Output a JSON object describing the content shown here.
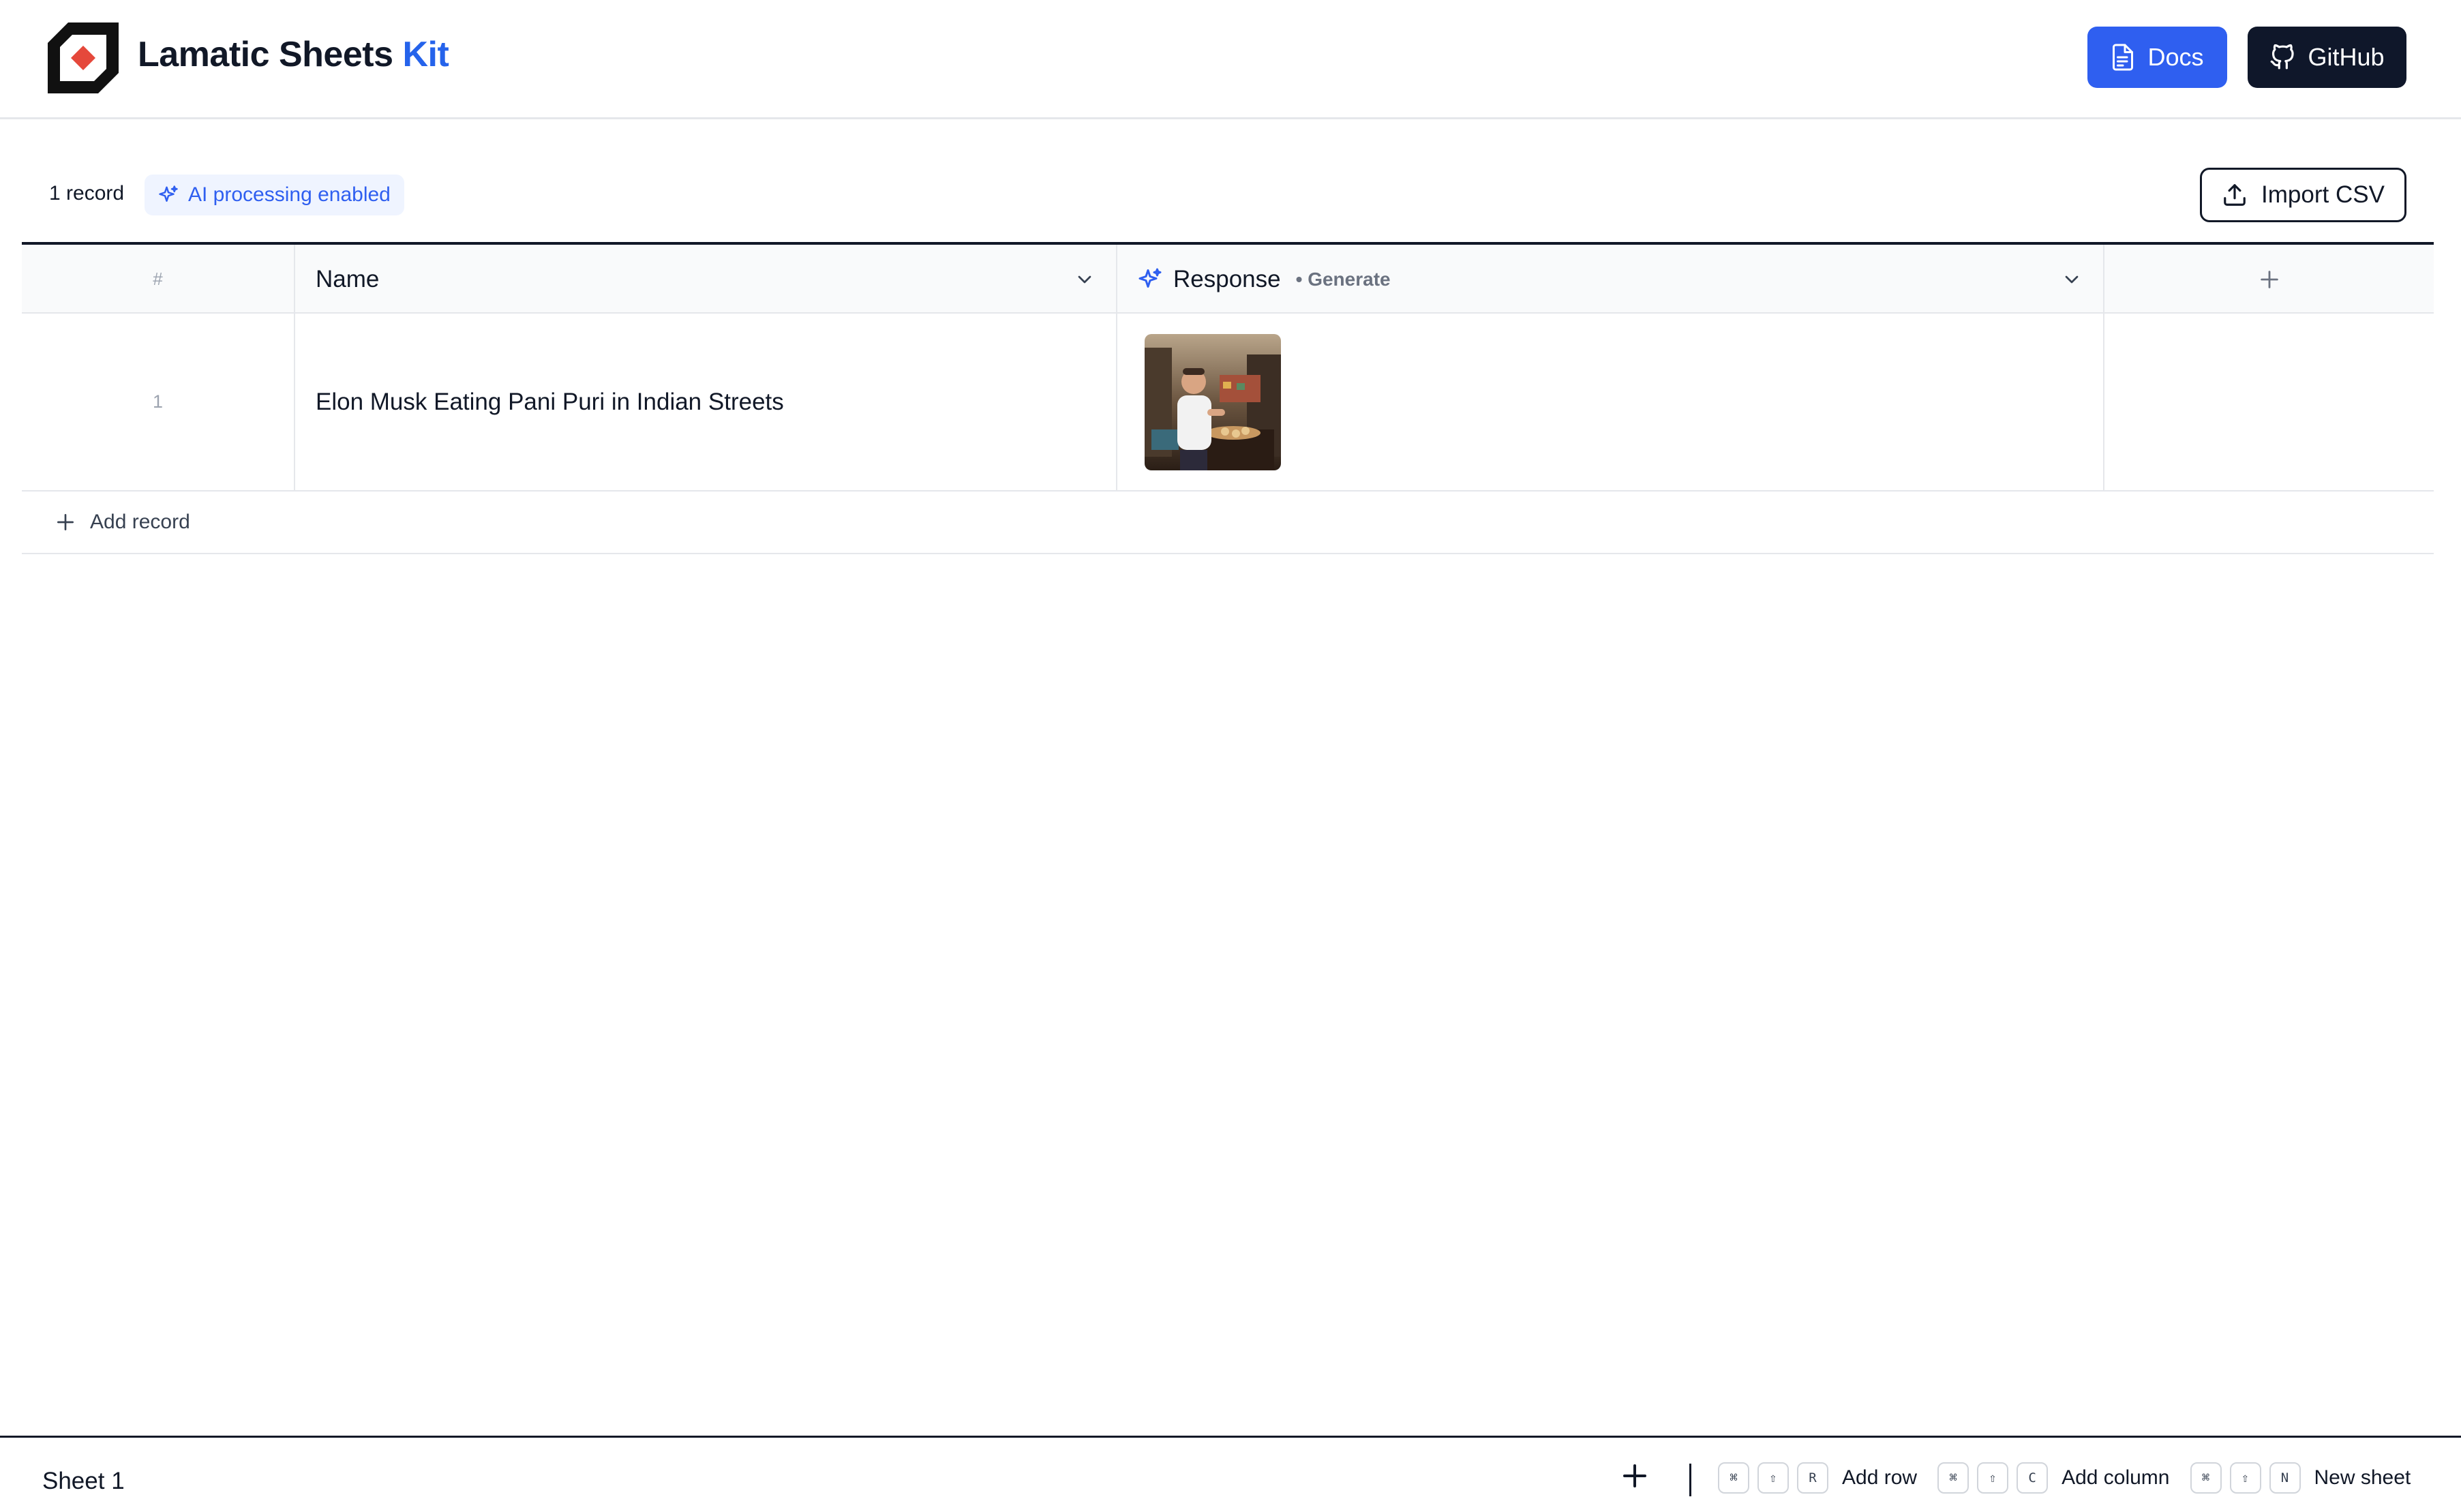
{
  "header": {
    "title_main": "Lamatic Sheets",
    "title_accent": "Kit",
    "docs_label": "Docs",
    "github_label": "GitHub",
    "colors": {
      "accent": "#2f5ff0",
      "dark": "#0f172a",
      "logo_red": "#e5483b"
    }
  },
  "toolbar": {
    "record_count": "1 record",
    "ai_badge": "AI processing enabled",
    "import_label": "Import CSV"
  },
  "table": {
    "columns": {
      "index": "#",
      "name": "Name",
      "response": "Response",
      "response_action": "• Generate"
    },
    "rows": [
      {
        "index": "1",
        "name": "Elon Musk Eating Pani Puri in Indian Streets",
        "response_type": "image"
      }
    ],
    "add_record_label": "Add record"
  },
  "footer": {
    "sheet_name": "Sheet 1",
    "shortcuts": [
      {
        "keys": [
          "⌘",
          "⇧",
          "R"
        ],
        "label": "Add row"
      },
      {
        "keys": [
          "⌘",
          "⇧",
          "C"
        ],
        "label": "Add column"
      },
      {
        "keys": [
          "⌘",
          "⇧",
          "N"
        ],
        "label": "New sheet"
      }
    ]
  },
  "icons": [
    "logo-icon",
    "document-icon",
    "github-icon",
    "sparkle-icon",
    "upload-icon",
    "chevron-down-icon",
    "plus-icon"
  ]
}
